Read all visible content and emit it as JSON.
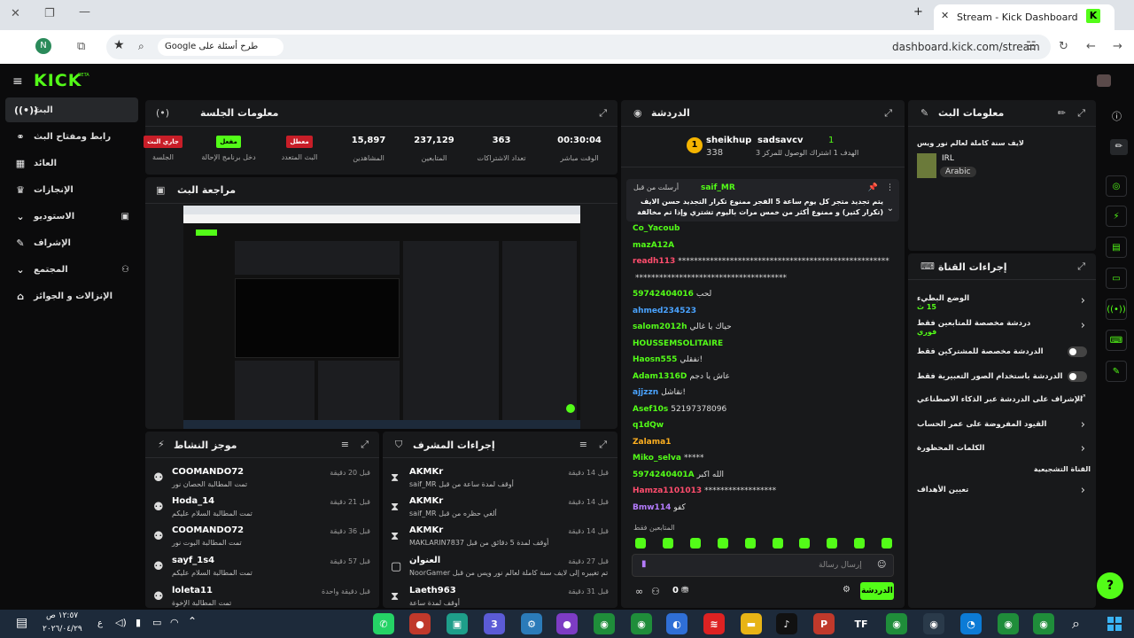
{
  "browser": {
    "tab_title": "Stream - Kick Dashboard",
    "url": "dashboard.kick.com/stream",
    "ask_google": "طرح أسئلة على Google",
    "profile_initial": "N"
  },
  "brand": {
    "logo": "KICK",
    "beta": "BETA",
    "accent": "#53fc18"
  },
  "sidebar": {
    "items": [
      {
        "label": "البث",
        "icon": "broadcast-icon"
      },
      {
        "label": "رابط ومفتاح البث",
        "icon": "link-icon"
      },
      {
        "label": "العائد",
        "icon": "revenue-icon"
      },
      {
        "label": "الإنجازات",
        "icon": "trophy-icon"
      },
      {
        "label": "الاستوديو",
        "icon": "studio-icon"
      },
      {
        "label": "الإشراف",
        "icon": "wrench-icon"
      },
      {
        "label": "المجتمع",
        "icon": "community-icon"
      },
      {
        "label": "الإنزالات و الجوائز",
        "icon": "drops-icon"
      }
    ]
  },
  "session": {
    "title": "معلومات الجلسة",
    "stats": [
      {
        "value": "00:30:04",
        "label": "الوقت مباشر"
      },
      {
        "value": "363",
        "label": "تعداد الاشتراكات"
      },
      {
        "value": "237,129",
        "label": "المتابعين"
      },
      {
        "value": "15,897",
        "label": "المشاهدين"
      }
    ],
    "badges": [
      {
        "badge": "معطل",
        "label": "البث المتعدد",
        "color": "#c81e28"
      },
      {
        "badge": "مفعل",
        "label": "دخل برنامج الإحالة",
        "color": "#53fc18"
      },
      {
        "badge": "جاري البث",
        "label": "الجلسة",
        "color": "#c81e28"
      }
    ]
  },
  "preview": {
    "title": "مراجعة البث"
  },
  "activity": {
    "title": "موجز النشاط",
    "rows": [
      {
        "user": "COOMANDO72",
        "sub": "تمت المطالبة الحصان نور",
        "time": "قبل 20 دقيقة"
      },
      {
        "user": "Hoda_14",
        "sub": "تمت المطالبة السلام عليكم",
        "time": "قبل 21 دقيقة"
      },
      {
        "user": "COOMANDO72",
        "sub": "تمت المطالبة البوت نور",
        "time": "قبل 36 دقيقة"
      },
      {
        "user": "sayf_1s4",
        "sub": "تمت المطالبة السلام عليكم",
        "time": "قبل 57 دقيقة"
      },
      {
        "user": "loleta11",
        "sub": "تمت المطالبة الإخوة",
        "time": "قبل دقيقة واحدة"
      }
    ]
  },
  "modlog": {
    "title": "إجراءات المشرف",
    "rows": [
      {
        "user": "AKMKr",
        "sub": "أوقف لمدة ساعة من قبل saif_MR",
        "time": "قبل 14 دقيقة"
      },
      {
        "user": "AKMKr",
        "sub": "ألغي حظره من قبل saif_MR",
        "time": "قبل 14 دقيقة"
      },
      {
        "user": "AKMKr",
        "sub": "أوقف لمدة 5 دقائق من قبل MAKLARIN7837",
        "time": "قبل 14 دقيقة"
      },
      {
        "user": "العنوان",
        "sub": "تم تغييره إلى لايف سنة كاملة لعالم نور ويس من قبل NoorGamer",
        "time": "قبل 27 دقيقة"
      },
      {
        "user": "Laeth963",
        "sub": "أوقف لمدة ساعة",
        "time": "قبل 31 دقيقة"
      }
    ]
  },
  "chat": {
    "title": "الدردشة",
    "top": {
      "rank": "1",
      "user1": "sheikhup",
      "count1": "338",
      "user2": "sadsavcv",
      "gift": "1",
      "goal": "الهدف 1 اشتراك الوصول للمركز 3"
    },
    "pinned": {
      "by": "saif_MR",
      "pinned_label": "أرسلت من قبل",
      "text": "يتم تجديد متجر كل يوم ساعة 5 الفجر ممنوع تكرار التجديد حسن الايف (تكرار كتير) و ممنوع أكثر من خمس مرات باليوم تشتري وإذا تم مخالفة القواعد تخصم نقاطك ولا تحصل شكاكة"
    },
    "messages": [
      {
        "user": "Co_Yacoub",
        "text": "",
        "color": "#53fc18"
      },
      {
        "user": "mazA12A",
        "text": "",
        "color": "#53fc18"
      },
      {
        "user": "readh113",
        "text": "*****************************************************",
        "color": "#ff4d6d"
      },
      {
        "user": "",
        "text": "**************************************",
        "color": "#ddd"
      },
      {
        "user": "59742404016",
        "text": "لحب",
        "color": "#53fc18"
      },
      {
        "user": "ahmed234523",
        "text": "",
        "color": "#4aa3ff"
      },
      {
        "user": "salom2012h",
        "text": "حياك يا غالي",
        "color": "#53fc18"
      },
      {
        "user": "HOUSSEMSOLITAIRE",
        "text": "",
        "color": "#53fc18"
      },
      {
        "user": "Haosn555",
        "text": "نفقلي!",
        "color": "#53fc18"
      },
      {
        "user": "Adam1316D",
        "text": "عاش يا دجم",
        "color": "#53fc18"
      },
      {
        "user": "ajjzzn",
        "text": "نقاشل!",
        "color": "#4aa3ff"
      },
      {
        "user": "Asef10s",
        "text": "52197378096",
        "color": "#53fc18"
      },
      {
        "user": "q1dQw",
        "text": "",
        "color": "#53fc18"
      },
      {
        "user": "Zalama1",
        "text": "",
        "color": "#ffb020"
      },
      {
        "user": "Miko_selva",
        "text": "*****",
        "color": "#53fc18"
      },
      {
        "user": "5974240401A",
        "text": "الله اكبر",
        "color": "#53fc18"
      },
      {
        "user": "Hamza1101013",
        "text": "******************",
        "color": "#ff4d6d"
      },
      {
        "user": "Bmw114",
        "text": "كفو",
        "color": "#b57cff"
      }
    ],
    "followers_only": "المتابعين فقط",
    "input_placeholder": "إرسال رسالة",
    "send_label": "الدردشة",
    "footer_count": "0"
  },
  "stream_info": {
    "title": "معلومات البث",
    "stream_title": "لايف سنة كاملة لعالم نور ويس",
    "category": "IRL",
    "language": "Arabic"
  },
  "channel_actions": {
    "title": "إجراءات القناة",
    "rows": [
      {
        "label": "الوضع البطيء",
        "sub": "15 ث",
        "kind": "chevron"
      },
      {
        "label": "دردشة مخصصة للمتابعين فقط",
        "sub": "فوري",
        "kind": "chevron"
      },
      {
        "label": "الدردشة مخصصة للمشتركين فقط",
        "sub": "",
        "kind": "toggle"
      },
      {
        "label": "الدردشة باستخدام الصور التعبيرية فقط",
        "sub": "",
        "kind": "toggle"
      },
      {
        "label": "الإشراف على الدردشة عبر الذكاء الاصطناعي",
        "sub": "",
        "kind": "link"
      },
      {
        "label": "القيود المفروضة على عمر الحساب",
        "sub": "",
        "kind": "chevron"
      },
      {
        "label": "الكلمات المحظورة",
        "sub": "",
        "kind": "chevron"
      }
    ],
    "section": "القناة التشجيعية",
    "goals": "تعيين الأهداف"
  },
  "taskbar": {
    "time": "١٢:٥٧ ص",
    "date": "٢٠٢٦/٠٤/٢٩",
    "lang": "ع"
  }
}
